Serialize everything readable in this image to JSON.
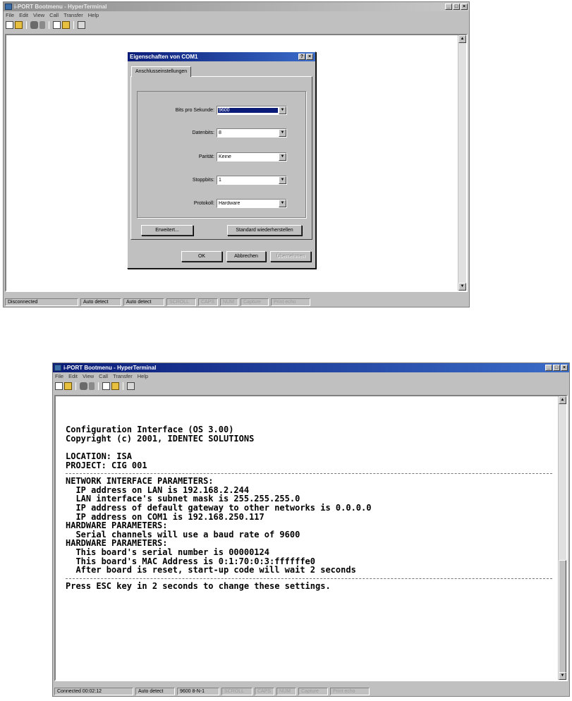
{
  "window1": {
    "title": "i-PORT Bootmenu - HyperTerminal",
    "menu": [
      "File",
      "Edit",
      "View",
      "Call",
      "Transfer",
      "Help"
    ],
    "status": [
      "Disconnected",
      "Auto detect",
      "Auto detect",
      "SCROLL",
      "CAPS",
      "NUM",
      "Capture",
      "Print echo"
    ],
    "dialog": {
      "title": "Eigenschaften von COM1",
      "help_btn": "?",
      "close_btn": "×",
      "tab": "Anschlusseinstellungen",
      "fields": [
        {
          "label": "Bits pro Sekunde:",
          "value": "9600"
        },
        {
          "label": "Datenbits:",
          "value": "8"
        },
        {
          "label": "Parität:",
          "value": "Keine"
        },
        {
          "label": "Stoppbits:",
          "value": "1"
        },
        {
          "label": "Protokoll:",
          "value": "Hardware"
        }
      ],
      "advanced_btn": "Erweitert...",
      "restore_btn": "Standard wiederherstellen",
      "ok_btn": "OK",
      "cancel_btn": "Abbrechen",
      "apply_btn": "Übernehmen"
    }
  },
  "window2": {
    "title": "i-PORT Bootmenu - HyperTerminal",
    "menu": [
      "File",
      "Edit",
      "View",
      "Call",
      "Transfer",
      "Help"
    ],
    "terminal_lines": [
      "",
      "",
      "Configuration Interface (OS 3.00)",
      "Copyright (c) 2001, IDENTEC SOLUTIONS",
      "",
      "LOCATION: ISA",
      "PROJECT: CIG 001",
      "---",
      "NETWORK INTERFACE PARAMETERS:",
      "  IP address on LAN is 192.168.2.244",
      "  LAN interface's subnet mask is 255.255.255.0",
      "  IP address of default gateway to other networks is 0.0.0.0",
      "  IP address on COM1 is 192.168.250.117",
      "HARDWARE PARAMETERS:",
      "  Serial channels will use a baud rate of 9600",
      "HARDWARE PARAMETERS:",
      "  This board's serial number is 00000124",
      "  This board's MAC Address is 0:1:70:0:3:ffffffe0",
      "  After board is reset, start-up code will wait 2 seconds",
      "---",
      "Press ESC key in 2 seconds to change these settings."
    ],
    "status": [
      "Connected 00:02:12",
      "Auto detect",
      "9600 8-N-1",
      "SCROLL",
      "CAPS",
      "NUM",
      "Capture",
      "Print echo"
    ]
  }
}
